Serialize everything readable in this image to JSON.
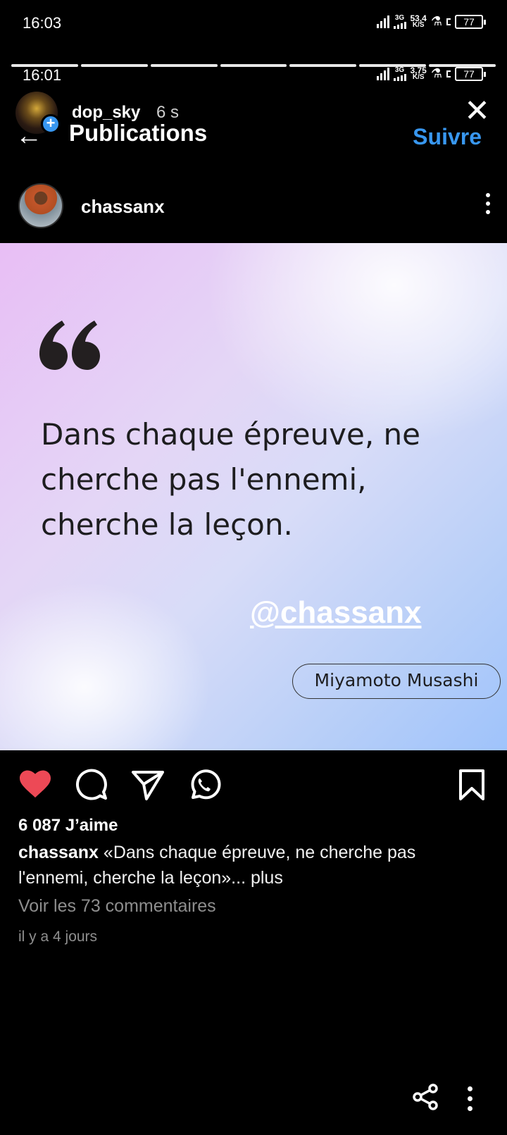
{
  "status_bar_top": {
    "time": "16:03",
    "network": "3G",
    "speed": "53,4",
    "speed_unit": "K/S",
    "battery": "77"
  },
  "status_bar_story": {
    "time": "16:01",
    "network": "3G",
    "speed": "3,75",
    "speed_unit": "K/S",
    "battery": "77"
  },
  "story": {
    "username": "dop_sky",
    "elapsed": "6 s",
    "title": "Publications",
    "follow_label": "Suivre",
    "progress_segments": 7
  },
  "post": {
    "username": "chassanx",
    "image": {
      "quote": "Dans chaque épreuve, ne cherche pas l'ennemi, cherche la leçon.",
      "handle": "@chassanx",
      "author": "Miyamoto Musashi"
    },
    "likes": "6 087 J’aime",
    "caption_user": "chassanx",
    "caption_text": "«Dans chaque épreuve, ne cherche pas l'ennemi, cherche la leçon»...",
    "caption_more": " plus",
    "comments_link": "Voir les 73 commentaires",
    "time_ago": "il y a 4 jours",
    "liked": true
  },
  "colors": {
    "accent": "#3897f0",
    "like": "#ed4956",
    "muted": "#8e8e8e"
  },
  "icons": [
    "heart-icon",
    "comment-icon",
    "send-icon",
    "whatsapp-icon",
    "bookmark-icon",
    "share-icon",
    "more-icon",
    "close-icon",
    "back-arrow-icon"
  ]
}
